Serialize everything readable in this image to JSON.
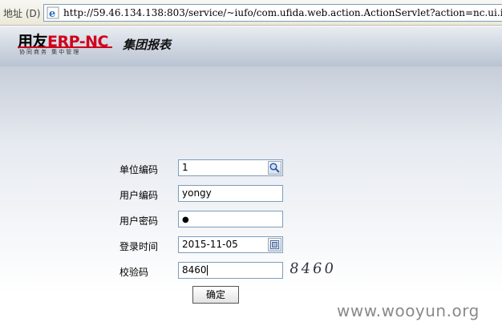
{
  "address_bar": {
    "label": "地址 (D)",
    "url": "http://59.46.134.138:803/service/~iufo/com.ufida.web.action.ActionServlet?action=nc.ui.iufo."
  },
  "header": {
    "logo_text_cn": "用友",
    "logo_text_erp": "ERP-NC",
    "logo_subtitle": "协同商务  集中管理",
    "system_title": "集团报表"
  },
  "form": {
    "unit_code": {
      "label": "单位编码",
      "value": "1"
    },
    "user_code": {
      "label": "用户编码",
      "value": "yongy"
    },
    "password": {
      "label": "用户密码",
      "value": "●"
    },
    "login_date": {
      "label": "登录时间",
      "value": "2015-11-05"
    },
    "captcha": {
      "label": "校验码",
      "value": "8460",
      "image_text": "8460"
    },
    "submit_label": "确定"
  },
  "watermark": "www.wooyun.org",
  "colors": {
    "brand_red": "#d0021b",
    "input_border": "#7f9db9",
    "header_gradient_top": "#e9ecf2",
    "header_gradient_bottom": "#b9c3d2"
  }
}
